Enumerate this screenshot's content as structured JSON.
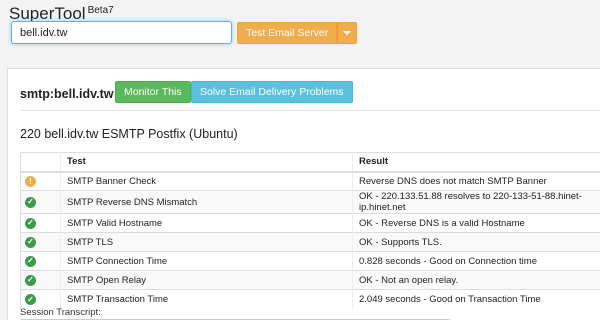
{
  "brand": {
    "title": "SuperTool",
    "badge": "Beta7"
  },
  "search": {
    "value": "bell.idv.tw"
  },
  "toolbar": {
    "action_label": "Test Email Server"
  },
  "panel": {
    "host_title": "smtp:bell.idv.tw",
    "monitor_label": "Monitor This",
    "solve_label": "Solve Email Delivery Problems",
    "banner": "220 bell.idv.tw ESMTP Postfix (Ubuntu)",
    "table": {
      "headers": {
        "test": "Test",
        "result": "Result"
      },
      "rows": [
        {
          "status": "warning",
          "test": "SMTP Banner Check",
          "result": "Reverse DNS does not match SMTP Banner"
        },
        {
          "status": "ok",
          "test": "SMTP Reverse DNS Mismatch",
          "result": "OK - 220.133.51.88 resolves to 220-133-51-88.hinet-ip.hinet.net"
        },
        {
          "status": "ok",
          "test": "SMTP Valid Hostname",
          "result": "OK - Reverse DNS is a valid Hostname"
        },
        {
          "status": "ok",
          "test": "SMTP TLS",
          "result": "OK - Supports TLS."
        },
        {
          "status": "ok",
          "test": "SMTP Connection Time",
          "result": "0.828 seconds - Good on Connection time"
        },
        {
          "status": "ok",
          "test": "SMTP Open Relay",
          "result": "OK - Not an open relay."
        },
        {
          "status": "ok",
          "test": "SMTP Transaction Time",
          "result": "2.049 seconds - Good on Transaction Time"
        }
      ]
    },
    "transcript_label": "Session Transcript:"
  },
  "colors": {
    "warning": "#f0ad4e",
    "ok": "#3c9b4a",
    "success_button": "#5cb85c",
    "info_button": "#5bc0de"
  },
  "icons": {
    "warning": "exclamation-circle-icon",
    "ok": "check-circle-icon"
  }
}
